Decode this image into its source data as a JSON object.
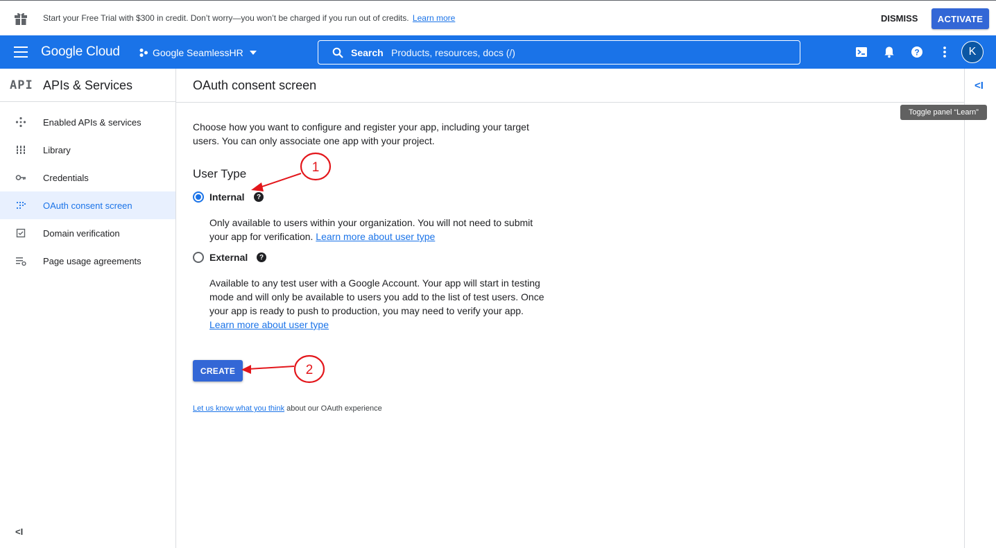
{
  "banner": {
    "message": "Start your Free Trial with $300 in credit. Don’t worry—you won’t be charged if you run out of credits.",
    "learn_more": "Learn more",
    "dismiss": "DISMISS",
    "activate": "ACTIVATE"
  },
  "topbar": {
    "logo": "Google Cloud",
    "project": "Google SeamlessHR",
    "search_label": "Search",
    "search_placeholder": "Products, resources, docs (/)",
    "avatar_initial": "K",
    "icons": [
      "menu-icon",
      "terminal-icon",
      "bell-icon",
      "help-icon",
      "more-vert-icon"
    ]
  },
  "sidebar": {
    "badge": "API",
    "title": "APIs & Services",
    "items": [
      {
        "label": "Enabled APIs & services",
        "icon": "diamond-arrows-icon",
        "active": false
      },
      {
        "label": "Library",
        "icon": "library-icon",
        "active": false
      },
      {
        "label": "Credentials",
        "icon": "key-icon",
        "active": false
      },
      {
        "label": "OAuth consent screen",
        "icon": "dots-grid-icon",
        "active": true
      },
      {
        "label": "Domain verification",
        "icon": "checkbox-icon",
        "active": false
      },
      {
        "label": "Page usage agreements",
        "icon": "list-settings-icon",
        "active": false
      }
    ],
    "collapse": "<I"
  },
  "main": {
    "title": "OAuth consent screen",
    "intro": "Choose how you want to configure and register your app, including your target users. You can only associate one app with your project.",
    "user_type_title": "User Type",
    "options": [
      {
        "label": "Internal",
        "selected": true,
        "description": "Only available to users within your organization. You will not need to submit your app for verification.",
        "link": "Learn more about user type"
      },
      {
        "label": "External",
        "selected": false,
        "description": "Available to any test user with a Google Account. Your app will start in testing mode and will only be available to users you add to the list of test users. Once your app is ready to push to production, you may need to verify your app.",
        "link": "Learn more about user type"
      }
    ],
    "create_button": "CREATE",
    "feedback_link": "Let us know what you think",
    "feedback_text": " about our OAuth experience"
  },
  "rail": {
    "toggle": "<I",
    "tooltip": "Toggle panel “Learn”"
  },
  "annotations": [
    {
      "number": "1",
      "color": "#e3161b"
    },
    {
      "number": "2",
      "color": "#e3161b"
    }
  ]
}
